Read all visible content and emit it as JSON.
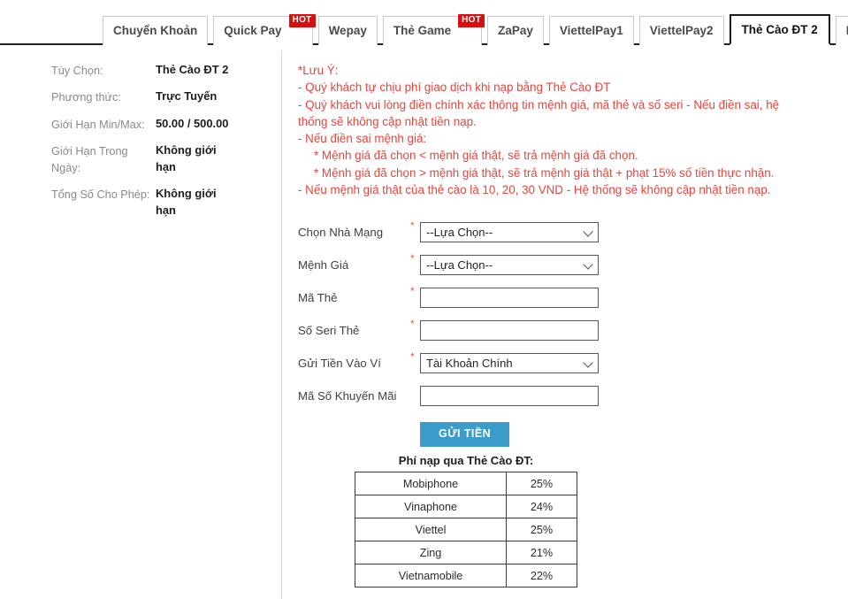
{
  "tabs": [
    {
      "label": "Chuyển Khoản",
      "badge": null,
      "active": false
    },
    {
      "label": "Quick Pay",
      "badge": "HOT",
      "active": false
    },
    {
      "label": "Wepay",
      "badge": null,
      "active": false
    },
    {
      "label": "Thẻ Game",
      "badge": "HOT",
      "active": false
    },
    {
      "label": "ZaPay",
      "badge": null,
      "active": false
    },
    {
      "label": "ViettelPay1",
      "badge": null,
      "active": false
    },
    {
      "label": "ViettelPay2",
      "badge": null,
      "active": false
    },
    {
      "label": "Thẻ Cào ĐT 2",
      "badge": null,
      "active": true
    },
    {
      "label": "Mopay",
      "badge": null,
      "active": false
    }
  ],
  "info": {
    "rows": [
      {
        "label": "Tùy Chọn:",
        "value": "Thẻ Cào ĐT 2"
      },
      {
        "label": "Phương thức:",
        "value": "Trực Tuyến"
      },
      {
        "label": "Giới Hạn Min/Max:",
        "value": "50.00 / 500.00"
      },
      {
        "label": "Giới Hạn Trong Ngày:",
        "value": "Không giới hạn"
      },
      {
        "label": "Tổng Số Cho Phép:",
        "value": "Không giới hạn"
      }
    ]
  },
  "notice": {
    "color": "#e8453c",
    "lines": [
      {
        "text": "*Lưu Ý:",
        "indent": false
      },
      {
        "text": "- Quý khách tự chịu phí giao dịch khi nạp bằng Thẻ Cào ĐT",
        "indent": false
      },
      {
        "text": "- Quý khách vui lòng điền chính xác thông tin mệnh giá, mã thẻ và số seri - Nếu điền sai, hệ thống sẽ không cập nhật tiền nạp.",
        "indent": false
      },
      {
        "text": "- Nếu điền sai mệnh giá:",
        "indent": false
      },
      {
        "text": "* Mệnh giá đã chọn < mệnh giá thật, sẽ trả mệnh giá đã chọn.",
        "indent": true
      },
      {
        "text": "* Mệnh giá đã chọn > mệnh giá thật, sẽ trả mệnh giá thật + phạt 15% số tiền thực nhận.",
        "indent": true
      },
      {
        "text": "- Nếu mệnh giá thật của thẻ cào là 10, 20, 30 VND - Hệ thống sẽ không cập nhật tiền nạp.",
        "indent": false
      }
    ]
  },
  "form": {
    "fields": [
      {
        "label": "Chọn Nhà Mạng",
        "required": true,
        "type": "select",
        "value": "--Lựa Chọn--",
        "placeholder": ""
      },
      {
        "label": "Mệnh Giá",
        "required": true,
        "type": "select",
        "value": "--Lựa Chọn--",
        "placeholder": ""
      },
      {
        "label": "Mã Thẻ",
        "required": true,
        "type": "text",
        "value": "",
        "placeholder": ""
      },
      {
        "label": "Số Seri Thẻ",
        "required": true,
        "type": "text",
        "value": "",
        "placeholder": ""
      },
      {
        "label": "Gửi Tiền Vào Ví",
        "required": true,
        "type": "select",
        "value": "Tài Khoản Chính",
        "placeholder": ""
      },
      {
        "label": "Mã Số Khuyến Mãi",
        "required": false,
        "type": "text",
        "value": "",
        "placeholder": ""
      }
    ],
    "submit_label": "GỬI TIỀN",
    "submit_color": "#3b9cc9",
    "required_marker": "*"
  },
  "fee_table": {
    "title": "Phí nạp qua Thẻ Cào ĐT:",
    "rows": [
      {
        "name": "Mobiphone",
        "fee": "25%"
      },
      {
        "name": "Vinaphone",
        "fee": "24%"
      },
      {
        "name": "Viettel",
        "fee": "25%"
      },
      {
        "name": "Zing",
        "fee": "21%"
      },
      {
        "name": "Vietnamobile",
        "fee": "22%"
      }
    ]
  }
}
